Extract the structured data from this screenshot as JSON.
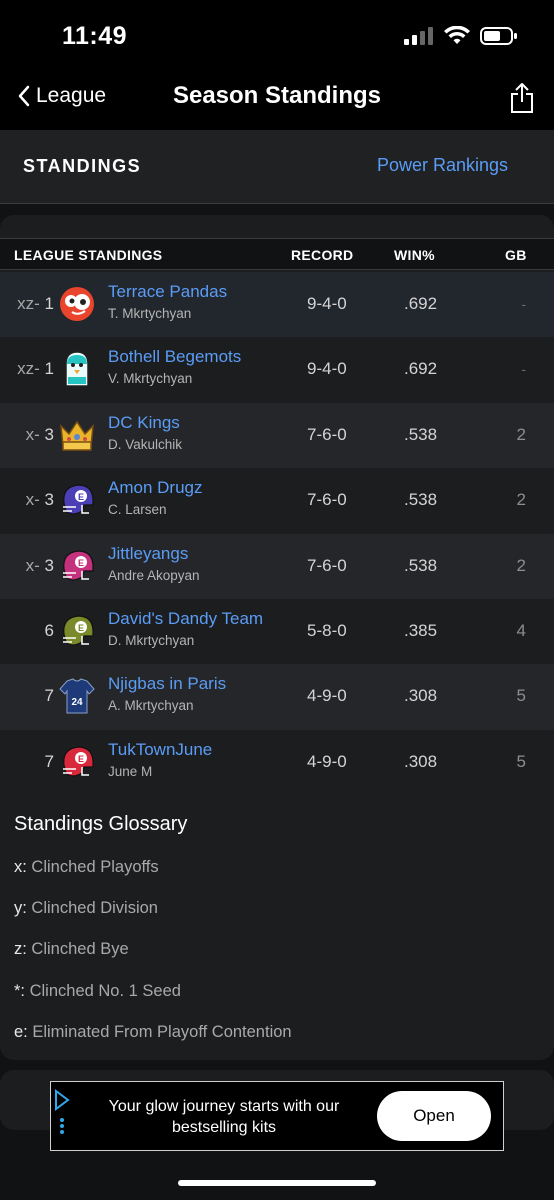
{
  "status_bar": {
    "time": "11:49"
  },
  "nav": {
    "back_label": "League",
    "title": "Season Standings"
  },
  "tabs": {
    "standings": "STANDINGS",
    "power_rankings": "Power Rankings"
  },
  "table": {
    "headers": {
      "league": "LEAGUE STANDINGS",
      "record": "RECORD",
      "win_pct": "WIN%",
      "gb": "GB"
    },
    "rows": [
      {
        "flag": "xz-",
        "rank": "1",
        "team": "Terrace Pandas",
        "owner": "T. Mkrtychyan",
        "record": "9-4-0",
        "win_pct": ".692",
        "gb": "-",
        "logo": "panda-logo-icon",
        "logo_color": "#e8452c"
      },
      {
        "flag": "xz-",
        "rank": "1",
        "team": "Bothell Begemots",
        "owner": "V. Mkrtychyan",
        "record": "9-4-0",
        "win_pct": ".692",
        "gb": "-",
        "logo": "penguin-logo-icon",
        "logo_color": "#27c4c4"
      },
      {
        "flag": "x-",
        "rank": "3",
        "team": "DC Kings",
        "owner": "D. Vakulchik",
        "record": "7-6-0",
        "win_pct": ".538",
        "gb": "2",
        "logo": "crown-logo-icon",
        "logo_color": "#e9b32a"
      },
      {
        "flag": "x-",
        "rank": "3",
        "team": "Amon Drugz",
        "owner": "C. Larsen",
        "record": "7-6-0",
        "win_pct": ".538",
        "gb": "2",
        "logo": "helmet-logo-icon",
        "logo_color": "#4a3fb5"
      },
      {
        "flag": "x-",
        "rank": "3",
        "team": "Jittleyangs",
        "owner": "Andre Akopyan",
        "record": "7-6-0",
        "win_pct": ".538",
        "gb": "2",
        "logo": "helmet-logo-icon",
        "logo_color": "#c4317c"
      },
      {
        "flag": "",
        "rank": "6",
        "team": "David's Dandy Team",
        "owner": "D. Mkrtychyan",
        "record": "5-8-0",
        "win_pct": ".385",
        "gb": "4",
        "logo": "helmet-logo-icon",
        "logo_color": "#7a8a2a"
      },
      {
        "flag": "",
        "rank": "7",
        "team": "Njigbas in Paris",
        "owner": "A. Mkrtychyan",
        "record": "4-9-0",
        "win_pct": ".308",
        "gb": "5",
        "logo": "jersey-logo-icon",
        "logo_color": "#1e3a78",
        "jersey_number": "24"
      },
      {
        "flag": "",
        "rank": "7",
        "team": "TukTownJune",
        "owner": "June M",
        "record": "4-9-0",
        "win_pct": ".308",
        "gb": "5",
        "logo": "helmet-logo-icon",
        "logo_color": "#d8283b"
      }
    ]
  },
  "glossary": {
    "title": "Standings Glossary",
    "items": [
      {
        "key": "x:",
        "text": " Clinched Playoffs"
      },
      {
        "key": "y:",
        "text": " Clinched Division"
      },
      {
        "key": "z:",
        "text": " Clinched Bye"
      },
      {
        "key": "*:",
        "text": " Clinched No. 1 Seed"
      },
      {
        "key": "e:",
        "text": " Eliminated From Playoff Contention"
      }
    ]
  },
  "ad": {
    "text": "Your glow journey starts with our bestselling kits",
    "button": "Open"
  }
}
